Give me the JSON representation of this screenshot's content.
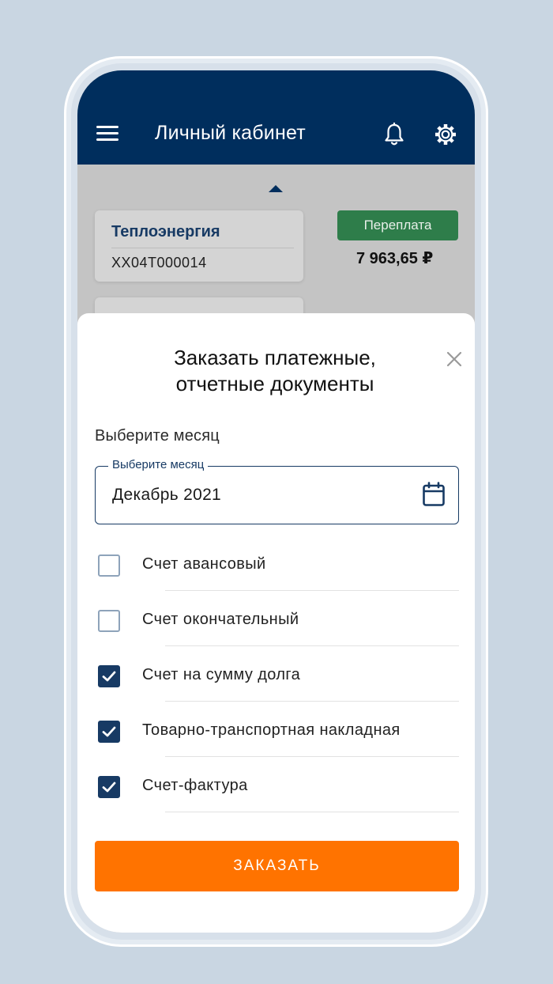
{
  "header": {
    "title": "Личный кабинет",
    "menu_icon": "menu-icon",
    "bell_icon": "bell-icon",
    "settings_icon": "gear-icon",
    "background_color": "#002e5d"
  },
  "account": {
    "name": "Теплоэнергия",
    "number": "XX04T000014",
    "status": "Переплата",
    "status_color": "#2e7d4a",
    "balance": "7 963,65 ₽"
  },
  "dialog": {
    "title_line1": "Заказать платежные,",
    "title_line2": "отчетные документы",
    "close_icon": "close-icon",
    "section_label": "Выберите месяц",
    "month_field": {
      "legend": "Выберите месяц",
      "value": "Декабрь 2021",
      "icon": "calendar-icon"
    },
    "documents": [
      {
        "label": "Счет авансовый",
        "checked": false
      },
      {
        "label": "Счет окончательный",
        "checked": false
      },
      {
        "label": "Счет на сумму долга",
        "checked": true
      },
      {
        "label": "Товарно-транспортная накладная",
        "checked": true
      },
      {
        "label": "Счет-фактура",
        "checked": true
      }
    ],
    "submit_label": "ЗАКАЗАТЬ",
    "submit_color": "#ff7300"
  }
}
